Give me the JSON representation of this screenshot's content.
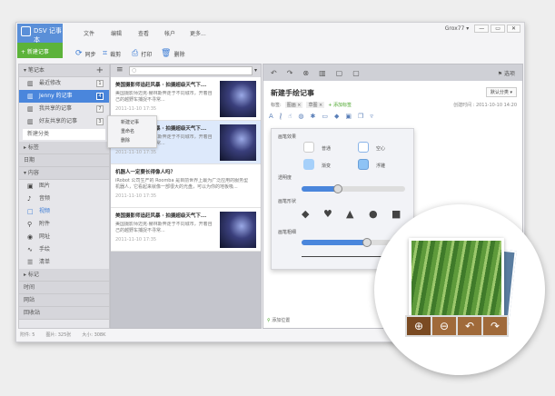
{
  "app": {
    "logo": "DSV 记事本",
    "new_note": "+ 新建记事",
    "user": "Grox77 ▾",
    "win_controls": [
      "—",
      "▭",
      "✕"
    ]
  },
  "menu": [
    "文件",
    "编辑",
    "查看",
    "帐户",
    "更多..."
  ],
  "toolbar": [
    {
      "icon": "sync-icon",
      "label": "同步"
    },
    {
      "icon": "crop-icon",
      "label": "裁剪"
    },
    {
      "icon": "print-icon",
      "label": "打印"
    },
    {
      "icon": "trash-icon",
      "label": "删除"
    }
  ],
  "sidebar": {
    "notebook_header": "笔记本",
    "notebooks": [
      {
        "label": "最近修改",
        "count": "1"
      },
      {
        "label": "Jenny 的记事",
        "count": "4"
      },
      {
        "label": "我共享的记事",
        "count": "7"
      },
      {
        "label": "好友共享的记事",
        "count": "3"
      }
    ],
    "new_category": "新建分类",
    "tags_header": "标签",
    "date_header": "日期",
    "content_header": "内容",
    "content_items": [
      {
        "icon": "image-icon",
        "label": "图片"
      },
      {
        "icon": "music-icon",
        "label": "音频"
      },
      {
        "icon": "video-icon",
        "label": "视频"
      },
      {
        "icon": "attachment-icon",
        "label": "附件"
      },
      {
        "icon": "globe-icon",
        "label": "网址"
      },
      {
        "icon": "handwriting-icon",
        "label": "手绘"
      },
      {
        "icon": "list-icon",
        "label": "清单"
      }
    ],
    "marks_header": "标记",
    "time_header": "时间",
    "site_header": "网站",
    "trash_header": "回收站"
  },
  "context_menu": [
    "新建记事",
    "重命名",
    "删除"
  ],
  "notes": [
    {
      "title": "美国摄影师追赶风暴 · 拍摄超级天气下...",
      "body": "美国摄影师迈克·赫林斯奔走于不同城市，开着自己的越野车捕捉不寻常...",
      "date": "2011-11-10 17:35",
      "image": true
    },
    {
      "title": "美国摄影师追赶风暴 · 拍摄超级天气下...",
      "body": "美国摄影师迈克·赫林斯奔走于不同城市，开着自己的越野车捕捉不寻常...",
      "date": "2011-11-10 17:35",
      "image": true
    },
    {
      "title": "机器人一定要长得像人吗？",
      "body": "iRobot 公司生产的 Roomba 是目前世界上最为广泛应用的服务型机器人，它看起来就像一部很大的光盘，可以为你的地板吸...",
      "date": "2011-11-10 17:35",
      "image": false
    },
    {
      "title": "美国摄影师追赶风暴 · 拍摄超级天气下...",
      "body": "美国摄影师迈克·赫林斯奔走于不同城市，开着自己的越野车捕捉不寻常...",
      "date": "2011-11-10 17:35",
      "image": true
    }
  ],
  "editor": {
    "options": "选项",
    "title": "新建手绘记事",
    "category": "默认分类 ▾",
    "tags_label": "标签:",
    "tags": [
      "图画 ×",
      "草图 ×"
    ],
    "add_tag": "+ 添加标签",
    "created": "创建时间 : 2011-10-10 14:20",
    "add_location": "添加位置"
  },
  "brush_popup": {
    "effect_label": "画笔效果",
    "effects": [
      "普通",
      "空心",
      "渐变",
      "浮雕"
    ],
    "opacity_label": "透明度",
    "opacity": 0.35,
    "shape_label": "画笔形状",
    "shapes": [
      "diamond",
      "heart",
      "triangle",
      "circle",
      "square"
    ],
    "size_label": "画笔粗细",
    "size": 0.6
  },
  "status": {
    "attachments": "附件: 5",
    "images": "图片: 325张",
    "size": "大小: 308K"
  },
  "magnifier": {
    "buttons": [
      "zoom-in-icon",
      "zoom-out-icon",
      "rotate-left-icon",
      "rotate-right-icon"
    ]
  },
  "colors": {
    "accent": "#4a86dc",
    "new_button": "#5cb33a",
    "magnifier_button": "#a06a3a"
  }
}
